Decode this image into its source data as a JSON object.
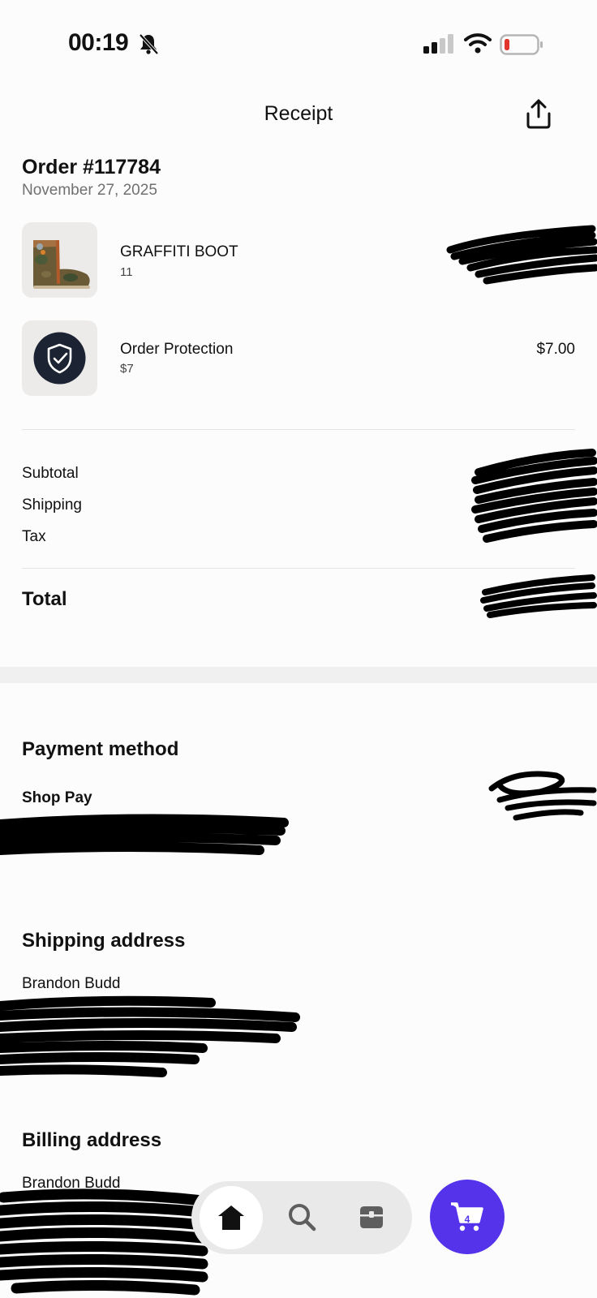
{
  "status_bar": {
    "time": "00:19",
    "battery_color": "#e0342c"
  },
  "nav": {
    "title": "Receipt",
    "share_icon": "share-icon"
  },
  "order": {
    "number": "Order #117784",
    "date": "November 27, 2025"
  },
  "items": [
    {
      "name": "GRAFFITI BOOT",
      "variant": "11",
      "price": ""
    },
    {
      "name": "Order Protection",
      "variant": "$7",
      "price": "$7.00"
    }
  ],
  "summary": {
    "subtotal_label": "Subtotal",
    "shipping_label": "Shipping",
    "tax_label": "Tax",
    "total_label": "Total"
  },
  "payment": {
    "title": "Payment method",
    "method": "Shop Pay"
  },
  "shipping_address": {
    "title": "Shipping address",
    "name": "Brandon Budd"
  },
  "billing_address": {
    "title": "Billing address",
    "name": "Brandon Budd"
  },
  "tab_bar": {
    "items": [
      "home-icon",
      "search-icon",
      "orders-icon"
    ],
    "cart_count": "4",
    "accent": "#5433eb"
  }
}
